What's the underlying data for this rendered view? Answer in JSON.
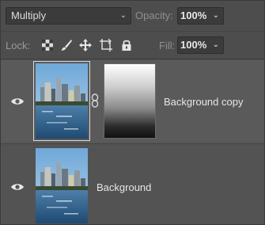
{
  "blend": {
    "mode": "Multiply"
  },
  "opacity": {
    "label": "Opacity:",
    "value": "100%"
  },
  "lock": {
    "label": "Lock:",
    "icons": [
      "lock-transparent-pixels-icon",
      "lock-image-pixels-icon",
      "lock-position-icon",
      "prevent-autonest-icon",
      "lock-all-icon"
    ]
  },
  "fill": {
    "label": "Fill:",
    "value": "100%"
  },
  "layers": [
    {
      "name": "Background copy",
      "visible": true,
      "has_mask": true,
      "selected": true
    },
    {
      "name": "Background",
      "visible": true,
      "has_mask": false,
      "selected": false
    }
  ],
  "colors": {
    "panel_bg": "#535353",
    "toolbar_bg": "#4d4d4d",
    "field_bg": "#3b3b3b",
    "text": "#e6e6e6",
    "muted_text": "#8f8f8f"
  }
}
